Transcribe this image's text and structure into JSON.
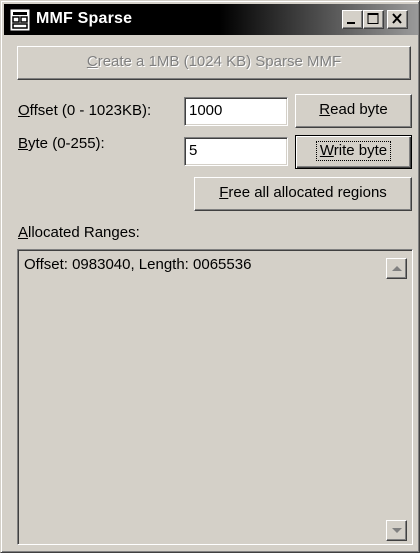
{
  "window": {
    "title": "MMF Sparse"
  },
  "titlebar": {
    "icon": "app-window-icon",
    "buttons": [
      "minimize-icon",
      "maximize-icon",
      "close-icon"
    ]
  },
  "create_button": {
    "mnemonic": "C",
    "rest": "reate a 1MB (1024 KB) Sparse MMF",
    "enabled": false
  },
  "offset": {
    "label_mnemonic": "O",
    "label_rest": "ffset (0 - 1023KB):",
    "value": "1000"
  },
  "byte": {
    "label_mnemonic": "B",
    "label_rest": "yte (0-255):",
    "value": "5"
  },
  "read_button": {
    "mnemonic": "R",
    "rest": "ead byte"
  },
  "write_button": {
    "mnemonic": "W",
    "rest": "rite byte",
    "is_default": true
  },
  "free_button": {
    "mnemonic": "F",
    "rest": "ree all allocated regions"
  },
  "ranges": {
    "label_mnemonic": "A",
    "label_rest": "llocated Ranges:",
    "items": [
      "Offset: 0983040, Length: 0065536"
    ]
  }
}
